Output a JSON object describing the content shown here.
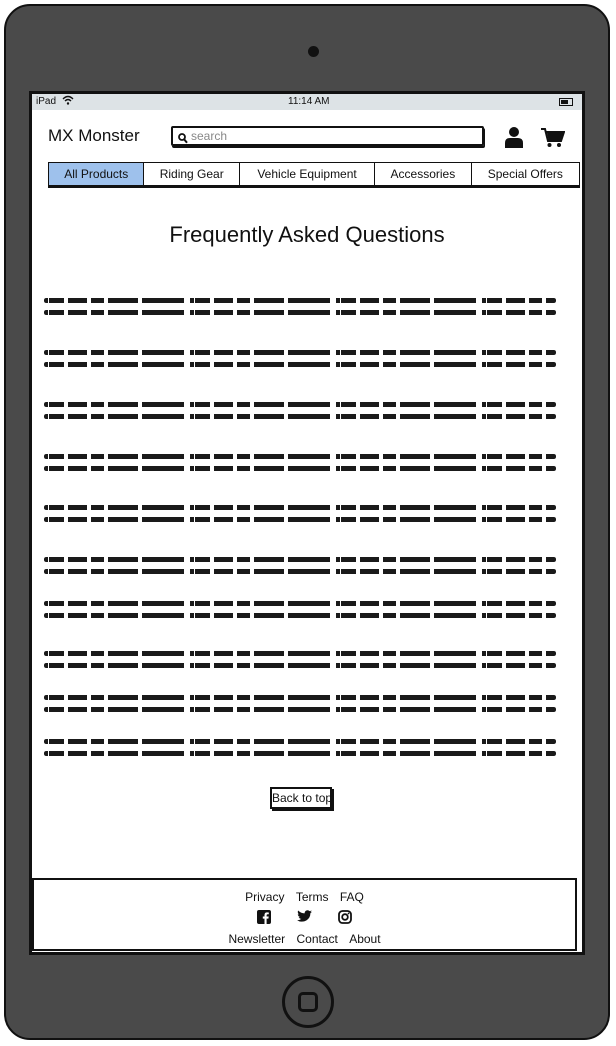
{
  "status_bar": {
    "carrier": "iPad",
    "time": "11:14 AM"
  },
  "header": {
    "brand": "MX Monster",
    "search_placeholder": "search",
    "icons": [
      "search-icon",
      "user-icon",
      "cart-icon"
    ]
  },
  "nav": {
    "tabs": [
      {
        "label": "All Products",
        "active": true
      },
      {
        "label": "Riding Gear",
        "active": false
      },
      {
        "label": "Vehicle Equipment",
        "active": false
      },
      {
        "label": "Accessories",
        "active": false
      },
      {
        "label": "Special Offers",
        "active": false
      }
    ]
  },
  "main": {
    "title": "Frequently Asked Questions",
    "faq_items": [
      {
        "text": ""
      },
      {
        "text": ""
      },
      {
        "text": ""
      },
      {
        "text": ""
      },
      {
        "text": ""
      },
      {
        "text": ""
      },
      {
        "text": ""
      },
      {
        "text": ""
      },
      {
        "text": ""
      },
      {
        "text": ""
      }
    ],
    "back_to_top": "Back to top"
  },
  "footer": {
    "links_top": [
      "Privacy",
      "Terms",
      "FAQ"
    ],
    "social_icons": [
      "facebook-icon",
      "twitter-icon",
      "instagram-icon"
    ],
    "links_bottom": [
      "Newsletter",
      "Contact",
      "About"
    ]
  },
  "colors": {
    "active_tab": "#9ec1ec",
    "device_frame": "#4a4a4a",
    "status_bar": "#dde3e6"
  }
}
